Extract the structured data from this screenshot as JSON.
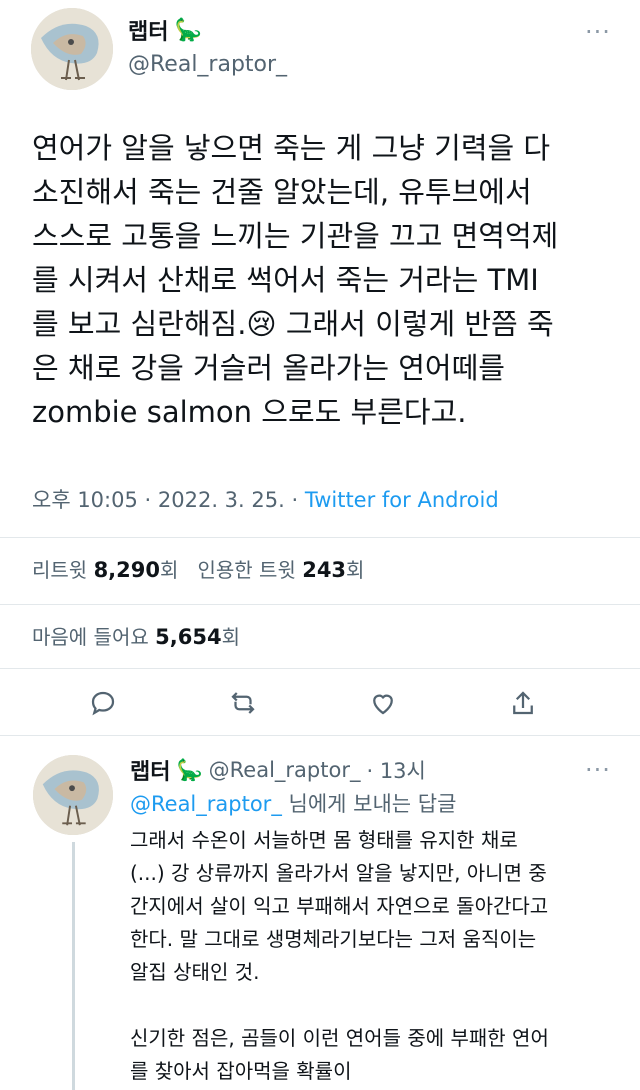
{
  "tweet": {
    "author_name": "랩터",
    "author_handle": "@Real_raptor_",
    "more_icon": "more-dots-icon",
    "text": "연어가 알을 낳으면 죽는 게 그냥 기력을 다\n소진해서 죽는 건줄 알았는데, 유투브에서\n스스로 고통을 느끼는 기관을 끄고 면역억제\n를 시켜서 산채로 썩어서 죽는 거라는 TMI\n를 보고 심란해짐.😢 그래서 이렇게 반쯤 죽\n은 채로 강을 거슬러 올라가는 연어떼를\nzombie salmon 으로도 부른다고.",
    "time": "오후 10:05",
    "date": "2022. 3. 25.",
    "source": "Twitter for Android",
    "retweets_label": "리트윗",
    "retweets_count": "8,290",
    "retweets_suffix": "회",
    "quotes_label": "인용한 트윗",
    "quotes_count": "243",
    "quotes_suffix": "회",
    "likes_label": "마음에 들어요",
    "likes_count": "5,654",
    "likes_suffix": "회"
  },
  "actions": [
    "reply-icon",
    "retweet-icon",
    "like-icon",
    "share-icon"
  ],
  "reply": {
    "author_name": "랩터",
    "author_handle": "@Real_raptor_",
    "time": "· 13시",
    "replying_handle": "@Real_raptor_",
    "replying_suffix": "님에게 보내는 답글",
    "text": "그래서 수온이 서늘하면 몸 형태를 유지한 채로\n(...) 강 상류까지 올라가서 알을 낳지만, 아니면 중\n간지에서 살이 익고 부패해서 자연으로 돌아간다고\n한다. 말 그대로 생명체라기보다는 그저 움직이는\n알집 상태인 것.\n\n신기한 점은, 곰들이 이런 연어들 중에 부패한 연어\n를 찾아서 잡아먹을 확률이"
  },
  "colors": {
    "link": "#1d9bf0",
    "text": "#0f1419",
    "secondary": "#536471",
    "divider": "#e3e8eb"
  }
}
